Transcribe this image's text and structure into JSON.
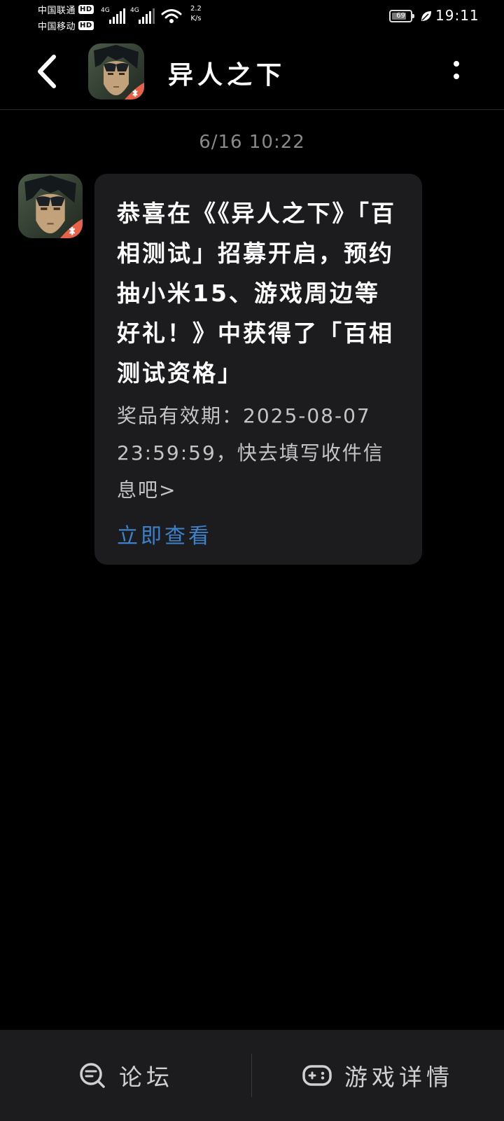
{
  "status_bar": {
    "carrier1": "中国联通",
    "carrier2": "中国移动",
    "hd_label": "HD",
    "network_type": "4G",
    "net_speed_value": "2.2",
    "net_speed_unit": "K/s",
    "battery_level": "69",
    "time": "19:11"
  },
  "header": {
    "title": "异人之下"
  },
  "conversation": {
    "timestamp": "6/16  10:22",
    "message": {
      "main_text": "恭喜在《《异人之下》「百相测试」招募开启，预约抽小米15、游戏周边等好礼！》中获得了「百相测试资格」",
      "sub_text": "奖品有效期：2025-08-07 23:59:59，快去填写收件信息吧>",
      "link_text": "立即查看"
    }
  },
  "bottom_bar": {
    "forum_label": "论坛",
    "game_detail_label": "游戏详情"
  },
  "colors": {
    "background": "#000000",
    "bubble": "#1c1c1e",
    "link": "#3b82c9",
    "timestamp": "#8a8a8a"
  }
}
